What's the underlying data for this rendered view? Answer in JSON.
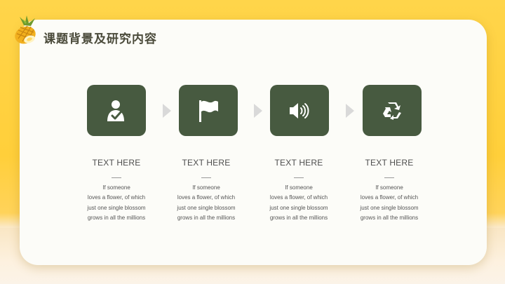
{
  "slide": {
    "title": "课题背景及研究内容"
  },
  "steps": [
    {
      "icon": "user-check-icon",
      "heading": "TEXT HERE",
      "lines": [
        "If someone",
        "loves a flower, of which",
        "just one single blossom",
        "grows in all the millions"
      ]
    },
    {
      "icon": "flag-icon",
      "heading": "TEXT HERE",
      "lines": [
        "If someone",
        "loves a flower, of which",
        "just one single blossom",
        "grows in all the millions"
      ]
    },
    {
      "icon": "speaker-icon",
      "heading": "TEXT HERE",
      "lines": [
        "If someone",
        "loves a flower, of which",
        "just one single blossom",
        "grows in all the millions"
      ]
    },
    {
      "icon": "recycle-icon",
      "heading": "TEXT HERE",
      "lines": [
        "If someone",
        "loves a flower, of which",
        "just one single blossom",
        "grows in all the millions"
      ]
    }
  ],
  "colors": {
    "background": "#ffd54a",
    "card": "#fcfcf8",
    "icon_tile": "#475a40",
    "arrow": "#d9d9d9",
    "text": "#4d4d4d"
  }
}
